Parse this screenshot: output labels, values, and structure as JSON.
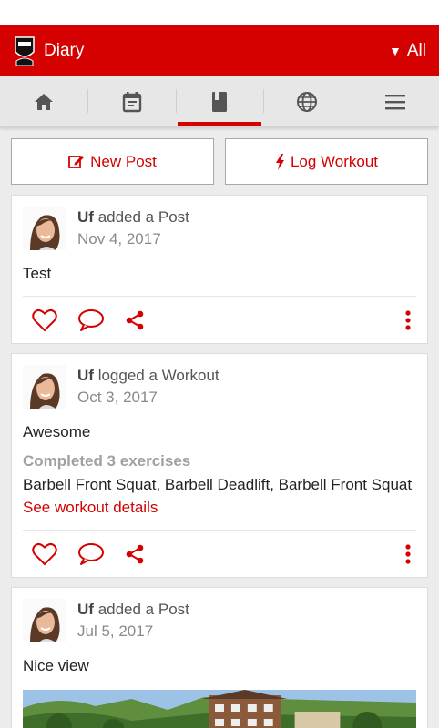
{
  "app": {
    "title": "Diary",
    "filter_label": "All"
  },
  "tabs": [
    {
      "icon": "home-icon",
      "active": false
    },
    {
      "icon": "calendar-icon",
      "active": false
    },
    {
      "icon": "book-icon",
      "active": true
    },
    {
      "icon": "globe-icon",
      "active": false
    },
    {
      "icon": "menu-icon",
      "active": false
    }
  ],
  "actions": {
    "new_post": "New Post",
    "log_workout": "Log Workout"
  },
  "colors": {
    "accent": "#d50000",
    "background": "#ececec"
  },
  "feed": [
    {
      "user": "Uf",
      "verb": "added a Post",
      "date": "Nov 4, 2017",
      "text": "Test"
    },
    {
      "user": "Uf",
      "verb": "logged a Workout",
      "date": "Oct 3, 2017",
      "text": "Awesome",
      "exercises_title": "Completed 3 exercises",
      "exercises": "Barbell Front Squat, Barbell Deadlift, Barbell Front Squat",
      "details_link": "See workout details"
    },
    {
      "user": "Uf",
      "verb": "added a Post",
      "date": "Jul 5, 2017",
      "text": "Nice view"
    }
  ]
}
